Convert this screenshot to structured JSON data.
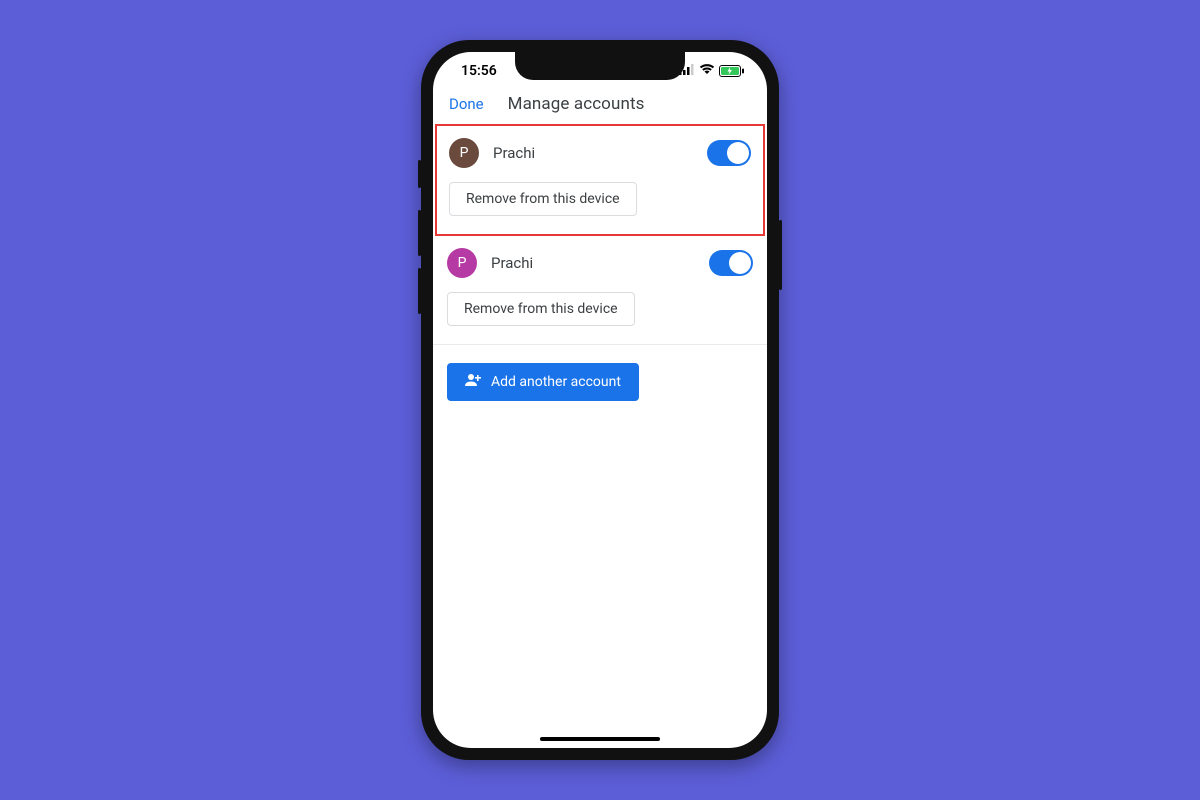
{
  "status": {
    "time": "15:56"
  },
  "header": {
    "done": "Done",
    "title": "Manage accounts"
  },
  "accounts": [
    {
      "initial": "P",
      "name": "Prachi",
      "remove_label": "Remove from this device"
    },
    {
      "initial": "P",
      "name": "Prachi",
      "remove_label": "Remove from this device"
    }
  ],
  "add_button": "Add another account",
  "colors": {
    "accent": "#1a73e8",
    "highlight": "#e53935",
    "background": "#5c5ed8"
  }
}
